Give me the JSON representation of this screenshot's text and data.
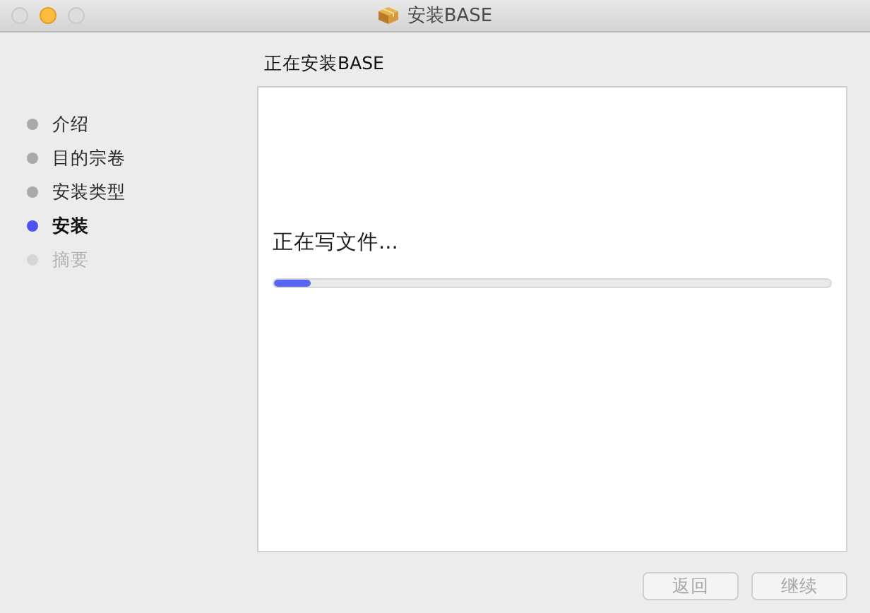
{
  "window": {
    "title": "安装BASE",
    "buttons": [
      {
        "kind": "close",
        "disabled": true
      },
      {
        "kind": "minimize",
        "disabled": false
      },
      {
        "kind": "zoom",
        "disabled": true
      }
    ]
  },
  "heading": "正在安装BASE",
  "steps": [
    {
      "label": "介绍",
      "selected": false,
      "disabled": false
    },
    {
      "label": "目的宗卷",
      "selected": false,
      "disabled": false
    },
    {
      "label": "安装类型",
      "selected": false,
      "disabled": false
    },
    {
      "label": "安装",
      "selected": true,
      "disabled": false
    },
    {
      "label": "摘要",
      "selected": false,
      "disabled": true
    }
  ],
  "status": "正在写文件...",
  "progress": {
    "level": 0.065
  },
  "buttons": [
    {
      "label": "返回",
      "disabled": true
    },
    {
      "label": "继续",
      "disabled": true
    }
  ]
}
